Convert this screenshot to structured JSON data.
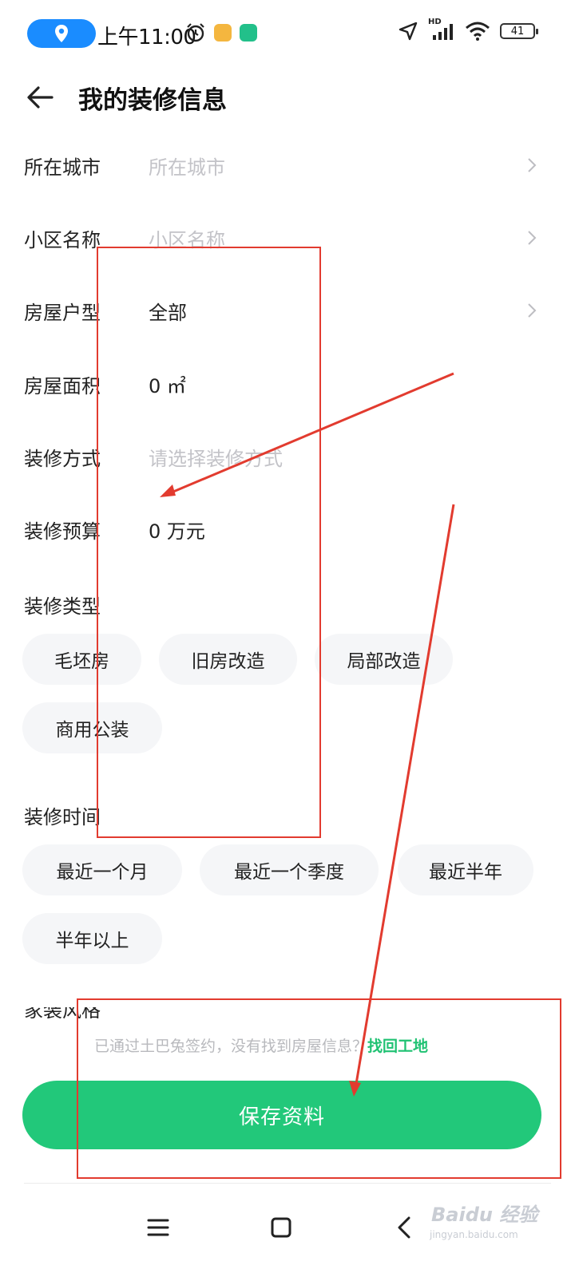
{
  "status_bar": {
    "time": "上午11:00",
    "battery": "41",
    "network": "HD"
  },
  "header": {
    "title": "我的装修信息"
  },
  "form": {
    "city": {
      "label": "所在城市",
      "value": "",
      "placeholder": "所在城市"
    },
    "community": {
      "label": "小区名称",
      "value": "",
      "placeholder": "小区名称"
    },
    "house_type": {
      "label": "房屋户型",
      "value": "全部"
    },
    "area": {
      "label": "房屋面积",
      "value": "0 ㎡"
    },
    "method": {
      "label": "装修方式",
      "value": "",
      "placeholder": "请选择装修方式"
    },
    "budget": {
      "label": "装修预算",
      "value": "0 万元"
    }
  },
  "renovation_type": {
    "label": "装修类型",
    "options": [
      "毛坯房",
      "旧房改造",
      "局部改造",
      "商用公装"
    ]
  },
  "renovation_time": {
    "label": "装修时间",
    "options": [
      "最近一个月",
      "最近一个季度",
      "最近半年",
      "半年以上"
    ]
  },
  "cut_off_label": "家装风格",
  "hint": {
    "text": "已通过土巴兔签约，没有找到房屋信息？",
    "link": "找回工地"
  },
  "save_button": "保存资料",
  "watermark": {
    "main": "Baidu 经验",
    "sub": "jingyan.baidu.com"
  },
  "colors": {
    "accent": "#22c87a",
    "link": "#20c273",
    "annotation": "#e23b2f",
    "chip_bg": "#f5f6f8"
  }
}
